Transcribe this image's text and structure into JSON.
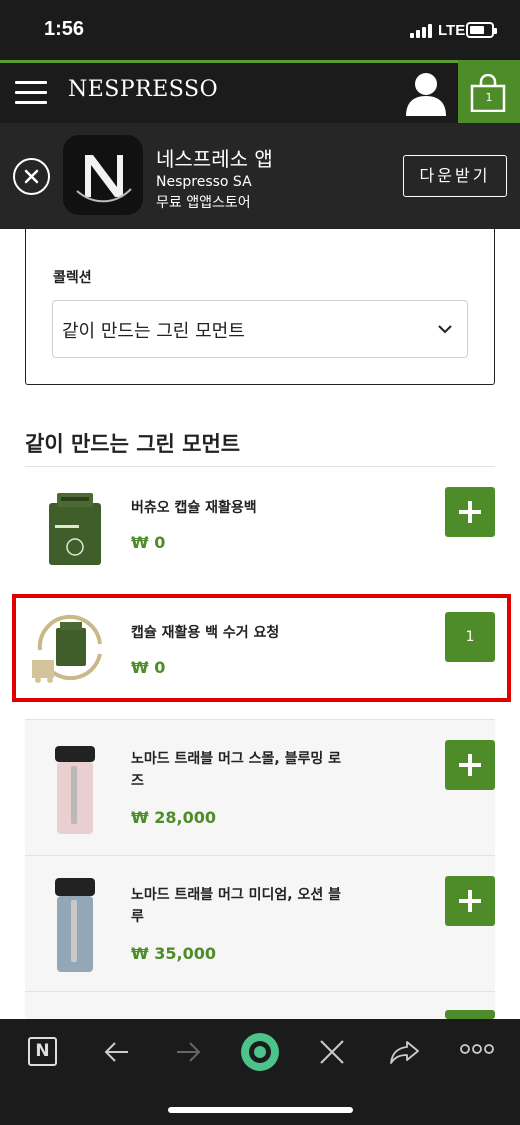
{
  "status_bar": {
    "time": "1:56",
    "network": "LTE"
  },
  "header": {
    "brand": "NESPRESSO",
    "cart_count": "1"
  },
  "app_banner": {
    "app_name": "네스프레소 앱",
    "publisher": "Nespresso SA",
    "store_text": "무료 앱앱스토어",
    "download_label": "다운받기"
  },
  "filter": {
    "label": "콜렉션",
    "selected": "같이 만드는 그린 모먼트"
  },
  "section": {
    "title": "같이 만드는 그린 모먼트"
  },
  "products": [
    {
      "name": "버츄오 캡슐 재활용백",
      "price": "₩ 0",
      "action": "add"
    },
    {
      "name": "캡슐 재활용 백 수거 요청",
      "price": "₩ 0",
      "action": "qty",
      "quantity": "1"
    },
    {
      "name": "노마드 트래블 머그 스몰, 블루밍 로즈",
      "price": "₩ 28,000",
      "action": "add"
    },
    {
      "name": "노마드 트래블 머그 미디엄, 오션 블루",
      "price": "₩ 35,000",
      "action": "add"
    }
  ],
  "colors": {
    "accent_green": "#4e8c2a",
    "highlight_red": "#e00000",
    "dark_bg": "#1b1b1b"
  },
  "toolbar": {
    "icons": [
      "nespresso-n-icon",
      "back-arrow-icon",
      "forward-arrow-icon",
      "home-circle-icon",
      "close-icon",
      "share-icon",
      "more-icon"
    ],
    "n_glyph": "N"
  }
}
